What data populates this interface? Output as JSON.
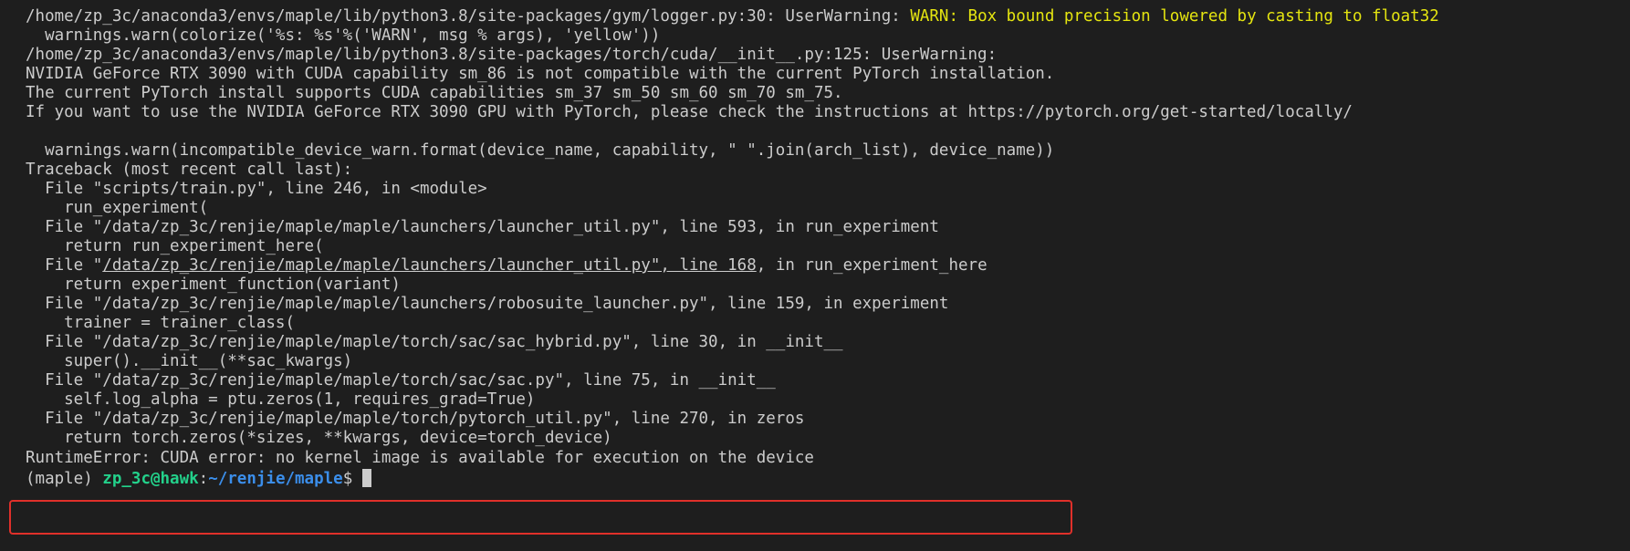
{
  "terminal": {
    "lines": [
      "/home/zp_3c/anaconda3/envs/maple/lib/python3.8/site-packages/gym/logger.py:30: UserWarning: ",
      "  warnings.warn(colorize('%s: %s'%('WARN', msg % args), 'yellow'))",
      "/home/zp_3c/anaconda3/envs/maple/lib/python3.8/site-packages/torch/cuda/__init__.py:125: UserWarning:",
      "NVIDIA GeForce RTX 3090 with CUDA capability sm_86 is not compatible with the current PyTorch installation.",
      "The current PyTorch install supports CUDA capabilities sm_37 sm_50 sm_60 sm_70 sm_75.",
      "If you want to use the NVIDIA GeForce RTX 3090 GPU with PyTorch, please check the instructions at https://pytorch.org/get-started/locally/",
      "",
      "  warnings.warn(incompatible_device_warn.format(device_name, capability, \" \".join(arch_list), device_name))",
      "Traceback (most recent call last):",
      "  File \"scripts/train.py\", line 246, in <module>",
      "    run_experiment(",
      "  File \"/data/zp_3c/renjie/maple/maple/launchers/launcher_util.py\", line 593, in run_experiment",
      "    return run_experiment_here(",
      "  File \"",
      "    return experiment_function(variant)",
      "  File \"/data/zp_3c/renjie/maple/maple/launchers/robosuite_launcher.py\", line 159, in experiment",
      "    trainer = trainer_class(",
      "  File \"/data/zp_3c/renjie/maple/maple/torch/sac/sac_hybrid.py\", line 30, in __init__",
      "    super().__init__(**sac_kwargs)",
      "  File \"/data/zp_3c/renjie/maple/maple/torch/sac/sac.py\", line 75, in __init__",
      "    self.log_alpha = ptu.zeros(1, requires_grad=True)",
      "  File \"/data/zp_3c/renjie/maple/maple/torch/pytorch_util.py\", line 270, in zeros",
      "    return torch.zeros(*sizes, **kwargs, device=torch_device)",
      "RuntimeError: CUDA error: no kernel image is available for execution on the device"
    ],
    "warn_message": "WARN: Box bound precision lowered by casting to float32",
    "link_text": "/data/zp_3c/renjie/maple/maple/launchers/launcher_util.py\", line 168",
    "link_suffix": ", in run_experiment_here",
    "prompt": {
      "env": "(maple) ",
      "user_host": "zp_3c@hawk",
      "colon": ":",
      "path": "~/renjie/maple",
      "symbol": "$ "
    }
  },
  "colors": {
    "background": "#1e1e1e",
    "text": "#cccccc",
    "warning_yellow": "#e5e510",
    "prompt_green": "#23d18b",
    "prompt_blue": "#3b8eea",
    "highlight_red": "#e0302a"
  }
}
